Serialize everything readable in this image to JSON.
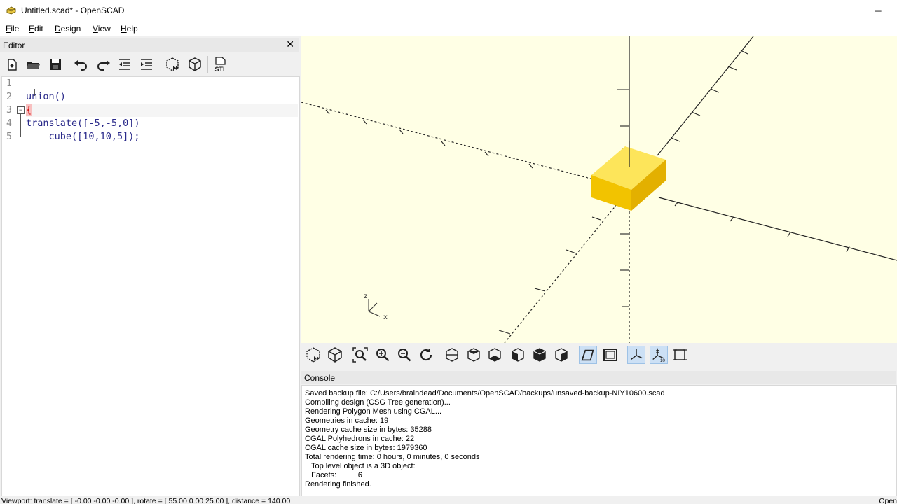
{
  "window": {
    "title": "Untitled.scad* - OpenSCAD",
    "minimize_glyph": "─",
    "close_glyph": "✕"
  },
  "menu": [
    {
      "key": "F",
      "rest": "ile"
    },
    {
      "key": "E",
      "rest": "dit"
    },
    {
      "key": "D",
      "rest": "esign"
    },
    {
      "key": "V",
      "rest": "iew"
    },
    {
      "key": "H",
      "rest": "elp"
    }
  ],
  "editor": {
    "title": "Editor",
    "close_glyph": "✕",
    "toolbar": [
      "new-icon",
      "open-icon",
      "save-icon",
      "undo-icon",
      "redo-icon",
      "unindent-icon",
      "indent-icon",
      "preview-icon",
      "render-icon",
      "export-stl-icon"
    ],
    "stl_label": "STL",
    "line_numbers": [
      "1",
      "2",
      "3",
      "4",
      "5"
    ],
    "lines": [
      "",
      "union()",
      "{",
      "translate([-5,-5,0])",
      "    cube([10,10,5]);"
    ],
    "fold_glyph": "−"
  },
  "viewport": {
    "background": "#ffffe5",
    "object_color": "#f9d72c",
    "axis_labels": {
      "x": "x",
      "z": "z"
    }
  },
  "viewport_toolbar": [
    "preview-icon",
    "render-icon",
    "view-all-icon",
    "zoom-in-icon",
    "zoom-out-icon",
    "reset-view-icon",
    "view-right-icon",
    "view-top-icon",
    "view-bottom-icon",
    "view-left-icon",
    "view-front-icon",
    "view-back-icon",
    "perspective-icon",
    "orthogonal-icon",
    "show-axes-icon",
    "show-scale-markers-icon",
    "show-edges-icon"
  ],
  "console": {
    "title": "Console",
    "lines": [
      "Saved backup file: C:/Users/braindead/Documents/OpenSCAD/backups/unsaved-backup-NIY10600.scad",
      "Compiling design (CSG Tree generation)...",
      "Rendering Polygon Mesh using CGAL...",
      "Geometries in cache: 19",
      "Geometry cache size in bytes: 35288",
      "CGAL Polyhedrons in cache: 22",
      "CGAL cache size in bytes: 1979360",
      "Total rendering time: 0 hours, 0 minutes, 0 seconds",
      "   Top level object is a 3D object:",
      "   Facets:          6",
      "Rendering finished."
    ]
  },
  "status": {
    "left": "Viewport: translate = [ -0.00 -0.00 -0.00 ], rotate = [ 55.00 0.00 25.00 ], distance = 140.00",
    "right": "Open"
  }
}
